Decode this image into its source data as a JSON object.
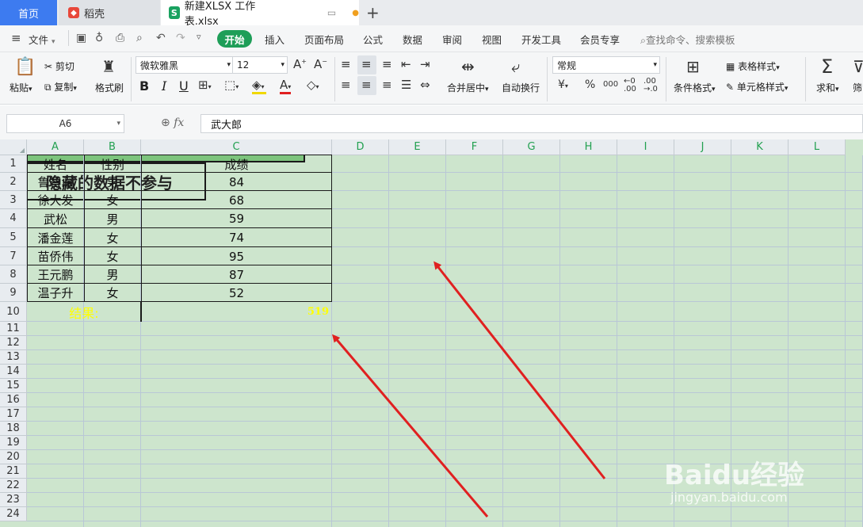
{
  "tabs": {
    "home": "首页",
    "daoke": "稻壳",
    "file": "新建XLSX 工作表.xlsx"
  },
  "menu": {
    "file": "文件",
    "items": [
      "开始",
      "插入",
      "页面布局",
      "公式",
      "数据",
      "审阅",
      "视图",
      "开发工具",
      "会员专享"
    ],
    "search_placeholder": "查找命令、搜索模板"
  },
  "ribbon": {
    "paste": "粘贴",
    "cut": "剪切",
    "copy": "复制",
    "format_painter": "格式刷",
    "font_name": "微软雅黑",
    "font_size": "12",
    "merge_center": "合并居中",
    "wrap_text": "自动换行",
    "number_format": "常规",
    "conditional_format": "条件格式",
    "table_style": "表格样式",
    "cell_style": "单元格样式",
    "sum": "求和",
    "filter": "筛"
  },
  "formula_bar": {
    "cell_ref": "A6",
    "fx": "fx",
    "content": "武大郎"
  },
  "sheet": {
    "columns": [
      "A",
      "B",
      "C",
      "D",
      "E",
      "F",
      "G",
      "H",
      "I",
      "J",
      "K",
      "L"
    ],
    "rows": [
      "1",
      "2",
      "3",
      "4",
      "5",
      "7",
      "8",
      "9",
      "10",
      "11",
      "12",
      "13",
      "14",
      "15",
      "16",
      "17",
      "18",
      "19",
      "20",
      "21",
      "22",
      "23",
      "24"
    ],
    "header": [
      "姓名",
      "性别",
      "成绩"
    ],
    "data": [
      [
        "鲁智深",
        "男",
        "84"
      ],
      [
        "徐大发",
        "女",
        "68"
      ],
      [
        "武松",
        "男",
        "59"
      ],
      [
        "潘金莲",
        "女",
        "74"
      ],
      [
        "苗侨伟",
        "女",
        "95"
      ],
      [
        "王元鹏",
        "男",
        "87"
      ],
      [
        "温子升",
        "女",
        "52"
      ]
    ],
    "result_label": "结果:",
    "result_value": "519",
    "note_text": "隐藏的数据不参与"
  },
  "colors": {
    "grid_bg": "#cde5cd",
    "result_bg": "#7dc47d",
    "result_text": "#ffff00",
    "accent": "#1e9e58",
    "arrow": "#e02020"
  },
  "watermark": {
    "brand": "Baidu经验",
    "url": "jingyan.baidu.com"
  }
}
